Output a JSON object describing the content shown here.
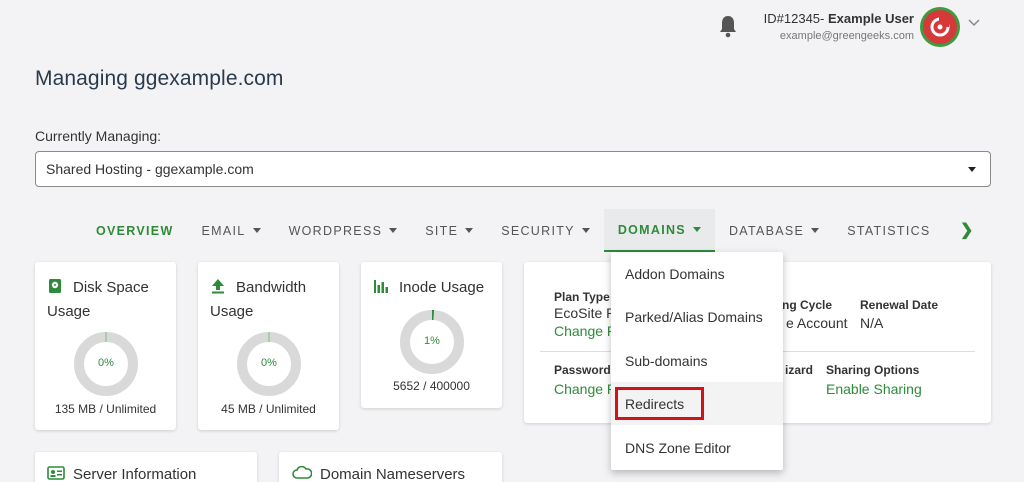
{
  "header": {
    "user_id": "ID#12345-",
    "user_name": "Example User",
    "user_email": "example@greengeeks.com"
  },
  "page_title": "Managing ggexample.com",
  "currently_managing": {
    "label": "Currently Managing:",
    "selected": "Shared Hosting - ggexample.com"
  },
  "tabs": [
    {
      "label": "OVERVIEW"
    },
    {
      "label": "EMAIL"
    },
    {
      "label": "WORDPRESS"
    },
    {
      "label": "SITE"
    },
    {
      "label": "SECURITY"
    },
    {
      "label": "DOMAINS"
    },
    {
      "label": "DATABASE"
    },
    {
      "label": "STATISTICS"
    }
  ],
  "cards": {
    "disk": {
      "title": "Disk Space Usage",
      "percent": "0%",
      "usage": "135 MB / Unlimited"
    },
    "bandwidth": {
      "title": "Bandwidth Usage",
      "percent": "0%",
      "usage": "45 MB / Unlimited"
    },
    "inode": {
      "title": "Inode Usage",
      "percent": "1%",
      "usage": "5652 / 400000"
    }
  },
  "plan": {
    "plan_type_label": "Plan Type",
    "plan_type_value": "EcoSite P",
    "plan_change": "Change P",
    "billing_label": "ng Cycle",
    "billing_value": "e Account",
    "renewal_label": "Renewal Date",
    "renewal_value": "N/A",
    "password_label": "Password",
    "password_change": "Change P",
    "wizard_label": "izard",
    "sharing_label": "Sharing Options",
    "sharing_link": "Enable Sharing"
  },
  "domains_menu": [
    {
      "label": "Addon Domains"
    },
    {
      "label": "Parked/Alias Domains"
    },
    {
      "label": "Sub-domains"
    },
    {
      "label": "Redirects"
    },
    {
      "label": "DNS Zone Editor"
    }
  ],
  "bottom_cards": {
    "server": "Server Information",
    "nameservers": "Domain Nameservers"
  },
  "colors": {
    "accent": "#2e8b3a",
    "highlight": "#d0121b"
  }
}
